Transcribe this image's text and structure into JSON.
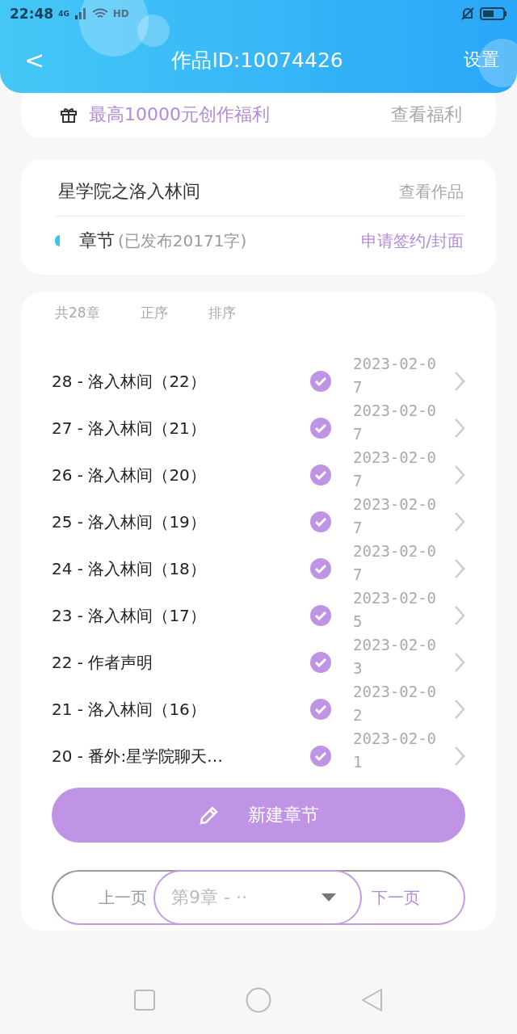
{
  "status_bar": {
    "time": "22:48",
    "network": "4G",
    "hd": "HD"
  },
  "header": {
    "back": "<",
    "title": "作品ID:10074426",
    "action": "设置"
  },
  "welfare": {
    "text": "最高10000元创作福利",
    "link": "查看福利"
  },
  "work": {
    "title": "星学院之洛入林间",
    "link": "查看作品",
    "section": "章节",
    "stats": "(已发布20171字)",
    "action": "申请签约/封面"
  },
  "chapters": {
    "count": "共28章",
    "sort_options": [
      "正序",
      "排序"
    ],
    "rows": [
      {
        "title": "28 - 洛入林间（22）",
        "published": true,
        "date": "2023-02-07"
      },
      {
        "title": "27 - 洛入林间（21）",
        "published": true,
        "date": "2023-02-07"
      },
      {
        "title": "26 - 洛入林间（20）",
        "published": true,
        "date": "2023-02-07"
      },
      {
        "title": "25 - 洛入林间（19）",
        "published": true,
        "date": "2023-02-07"
      },
      {
        "title": "24 - 洛入林间（18）",
        "published": true,
        "date": "2023-02-07"
      },
      {
        "title": "23 - 洛入林间（17）",
        "published": true,
        "date": "2023-02-05"
      },
      {
        "title": "22 - 作者声明",
        "published": true,
        "date": "2023-02-03"
      },
      {
        "title": "21 - 洛入林间（16）",
        "published": true,
        "date": "2023-02-02"
      },
      {
        "title": "20 - 番外:星学院聊天…",
        "published": true,
        "date": "2023-02-01"
      }
    ],
    "new_button": "新建章节",
    "pager": {
      "prev": "上一页",
      "select": "第9章 - ··",
      "next": "下一页"
    }
  }
}
